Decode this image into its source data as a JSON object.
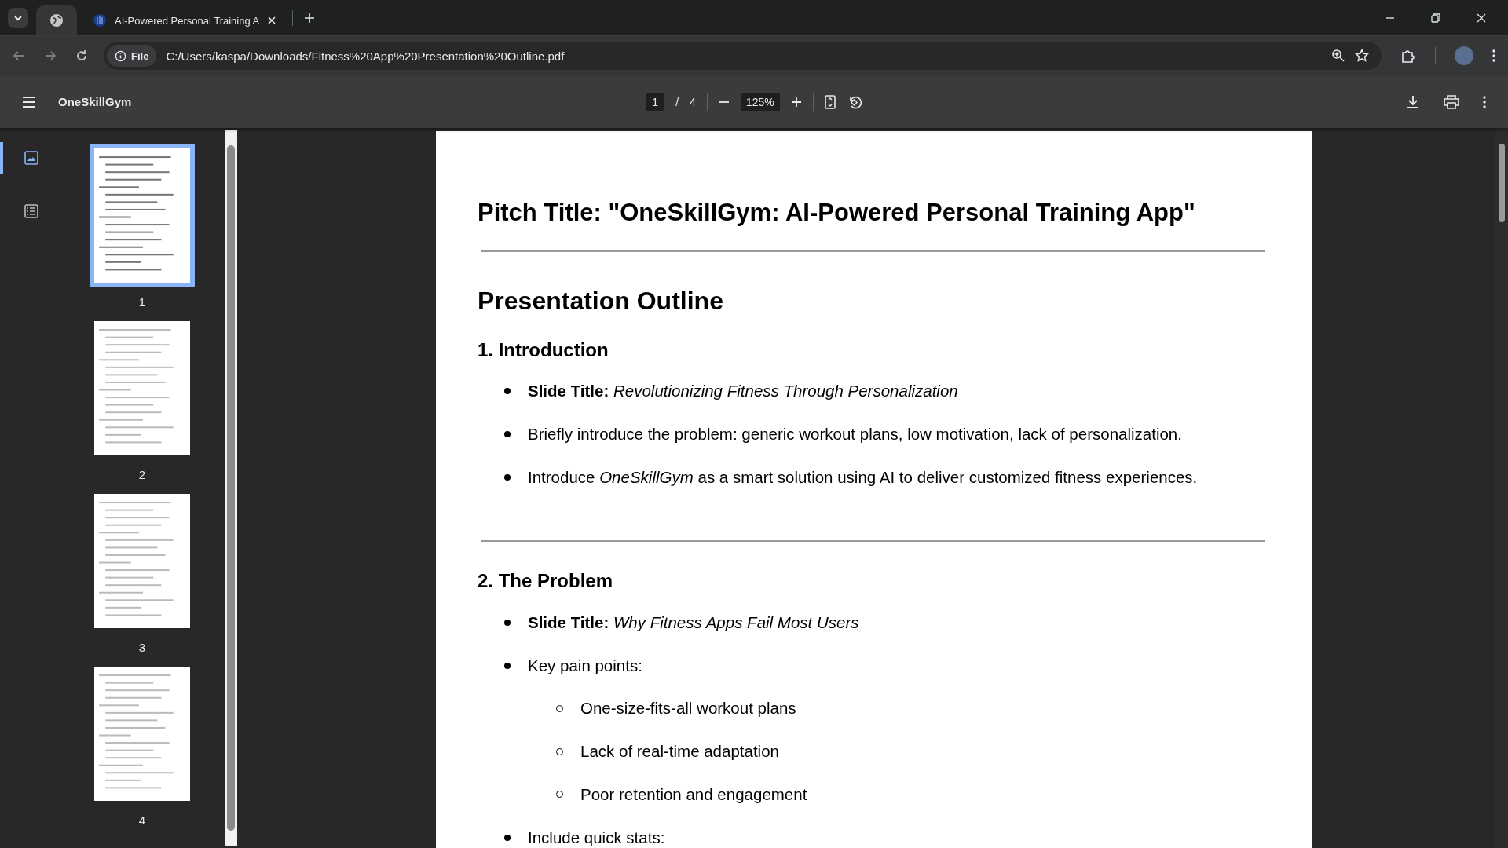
{
  "browser": {
    "tabs": [
      {
        "kind": "pinned",
        "selected": true
      },
      {
        "kind": "normal",
        "title": "AI-Powered Personal Training A",
        "selected": false
      }
    ],
    "address": {
      "scheme_label": "File",
      "url": "C:/Users/kaspa/Downloads/Fitness%20App%20Presentation%20Outline.pdf"
    }
  },
  "viewer": {
    "title": "OneSkillGym",
    "current_page": "1",
    "page_separator": "/",
    "page_count": "4",
    "zoom": "125%"
  },
  "thumbnails": [
    {
      "label": "1",
      "selected": true
    },
    {
      "label": "2",
      "selected": false
    },
    {
      "label": "3",
      "selected": false
    },
    {
      "label": "4",
      "selected": false
    }
  ],
  "sidebar_views": [
    {
      "kind": "thumbnails",
      "selected": true
    },
    {
      "kind": "outline",
      "selected": false
    }
  ],
  "document": {
    "title": "Pitch Title: \"OneSkillGym: AI-Powered Personal Training App\"",
    "sections": [
      {
        "kind": "heading1",
        "text": "Presentation Outline"
      },
      {
        "kind": "heading2",
        "text": "1. Introduction",
        "items": [
          {
            "text": "**Slide Title:** *Revolutionizing Fitness Through Personalization*"
          },
          {
            "text": "Briefly introduce the problem: generic workout plans, low motivation, lack of personalization."
          },
          {
            "text": "Introduce *OneSkillGym* as a smart solution using AI to deliver customized fitness experiences."
          }
        ]
      },
      {
        "kind": "rule"
      },
      {
        "kind": "heading2",
        "text": "2. The Problem",
        "items": [
          {
            "text": "**Slide Title:** *Why Fitness Apps Fail Most Users*"
          },
          {
            "text": "Key pain points:",
            "children": [
              {
                "text": "One-size-fits-all workout plans"
              },
              {
                "text": "Lack of real-time adaptation"
              },
              {
                "text": "Poor retention and engagement"
              }
            ]
          },
          {
            "text": "Include quick stats:"
          }
        ]
      }
    ]
  }
}
